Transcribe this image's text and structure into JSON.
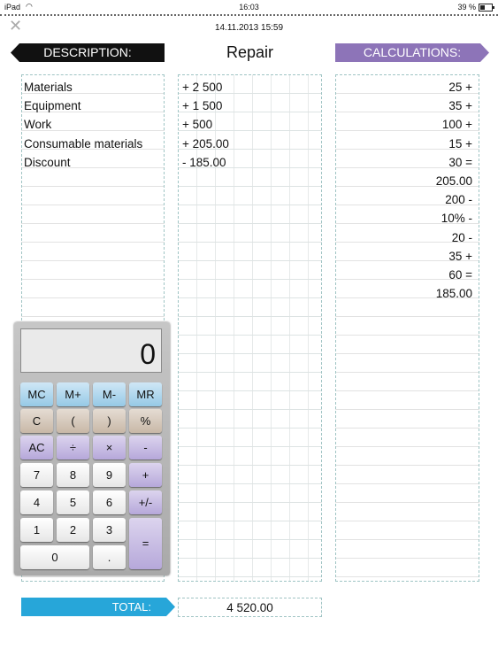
{
  "status_bar": {
    "device": "iPad",
    "time": "16:03",
    "battery": "39 %"
  },
  "header": {
    "datetime": "14.11.2013 15:59",
    "title": "Repair",
    "close_icon": "close-x-icon"
  },
  "banners": {
    "description": "DESCRIPTION:",
    "calculations": "CALCULATIONS:",
    "total": "TOTAL:"
  },
  "colors": {
    "description_banner": "#111111",
    "calculations_banner": "#8d74b8",
    "total_banner": "#27a6d9"
  },
  "items": [
    {
      "description": "Materials",
      "value": "+ 2 500"
    },
    {
      "description": "Equipment",
      "value": "+ 1 500"
    },
    {
      "description": "Work",
      "value": "+ 500"
    },
    {
      "description": "Consumable materials",
      "value": "+ 205.00"
    },
    {
      "description": "Discount",
      "value": "- 185.00"
    }
  ],
  "calculations": [
    "25 +",
    "35 +",
    "100 +",
    "15 +",
    "30 =",
    "205.00",
    "200 -",
    "10% -",
    "20 -",
    "35 +",
    "60 =",
    "185.00"
  ],
  "calculator": {
    "display": "0",
    "keys": [
      "MC",
      "M+",
      "M-",
      "MR",
      "C",
      "(",
      ")",
      "%",
      "AC",
      "÷",
      "×",
      "-",
      "7",
      "8",
      "9",
      "+",
      "4",
      "5",
      "6",
      "+/-",
      "1",
      "2",
      "3",
      "=",
      "0",
      "."
    ]
  },
  "total": {
    "value": "4 520.00"
  }
}
